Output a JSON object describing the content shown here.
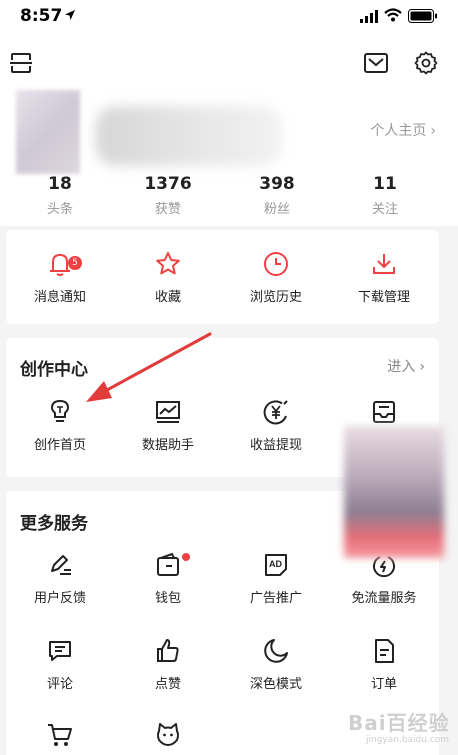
{
  "status_bar": {
    "time": "8:57"
  },
  "profile": {
    "homepage_link": "个人主页",
    "stats": [
      {
        "value": "18",
        "label": "头条"
      },
      {
        "value": "1376",
        "label": "获赞"
      },
      {
        "value": "398",
        "label": "粉丝"
      },
      {
        "value": "11",
        "label": "关注"
      }
    ]
  },
  "quick_actions": {
    "items": [
      {
        "label": "消息通知",
        "icon": "bell-icon",
        "badge": "5"
      },
      {
        "label": "收藏",
        "icon": "star-icon"
      },
      {
        "label": "浏览历史",
        "icon": "clock-icon"
      },
      {
        "label": "下载管理",
        "icon": "download-icon"
      }
    ]
  },
  "creation_center": {
    "title": "创作中心",
    "enter_label": "进入",
    "items": [
      {
        "label": "创作首页",
        "icon": "lightbulb-icon"
      },
      {
        "label": "数据助手",
        "icon": "chart-icon"
      },
      {
        "label": "收益提现",
        "icon": "yen-icon"
      },
      {
        "label": "",
        "icon": "inbox-icon"
      }
    ]
  },
  "more_services": {
    "title": "更多服务",
    "items": [
      {
        "label": "用户反馈",
        "icon": "pencil-icon"
      },
      {
        "label": "钱包",
        "icon": "wallet-icon"
      },
      {
        "label": "广告推广",
        "icon": "ad-icon",
        "icon_text": "AD"
      },
      {
        "label": "免流量服务",
        "icon": "data-saver-icon"
      },
      {
        "label": "评论",
        "icon": "comment-icon"
      },
      {
        "label": "点赞",
        "icon": "thumbs-up-icon"
      },
      {
        "label": "深色模式",
        "icon": "moon-icon"
      },
      {
        "label": "订单",
        "icon": "order-icon"
      },
      {
        "label": "",
        "icon": "cart-icon"
      },
      {
        "label": "",
        "icon": "cat-icon"
      }
    ]
  },
  "watermark": {
    "brand": "Bai百经验",
    "url": "jingyan.baidu.com"
  },
  "colors": {
    "accent": "#f04142",
    "icon": "#222222",
    "muted": "#999999",
    "background": "#f4f4f4"
  }
}
